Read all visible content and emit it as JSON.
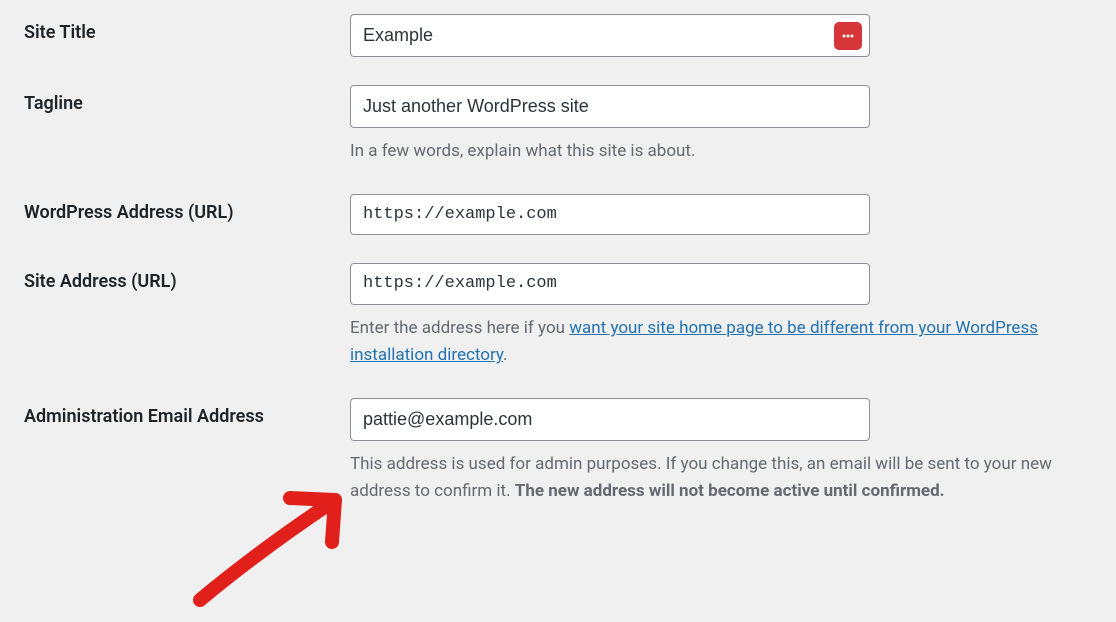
{
  "rows": {
    "site_title": {
      "label": "Site Title",
      "value": "Example"
    },
    "tagline": {
      "label": "Tagline",
      "value": "Just another WordPress site",
      "description": "In a few words, explain what this site is about."
    },
    "wp_address": {
      "label": "WordPress Address (URL)",
      "value": "https://example.com"
    },
    "site_address": {
      "label": "Site Address (URL)",
      "value": "https://example.com",
      "description_prefix": "Enter the address here if you ",
      "description_link": "want your site home page to be different from your WordPress installation directory",
      "description_suffix": "."
    },
    "admin_email": {
      "label": "Administration Email Address",
      "value": "pattie@example.com",
      "description_prefix": "This address is used for admin purposes. If you change this, an email will be sent to your new address to confirm it. ",
      "description_strong": "The new address will not become active until confirmed."
    }
  }
}
